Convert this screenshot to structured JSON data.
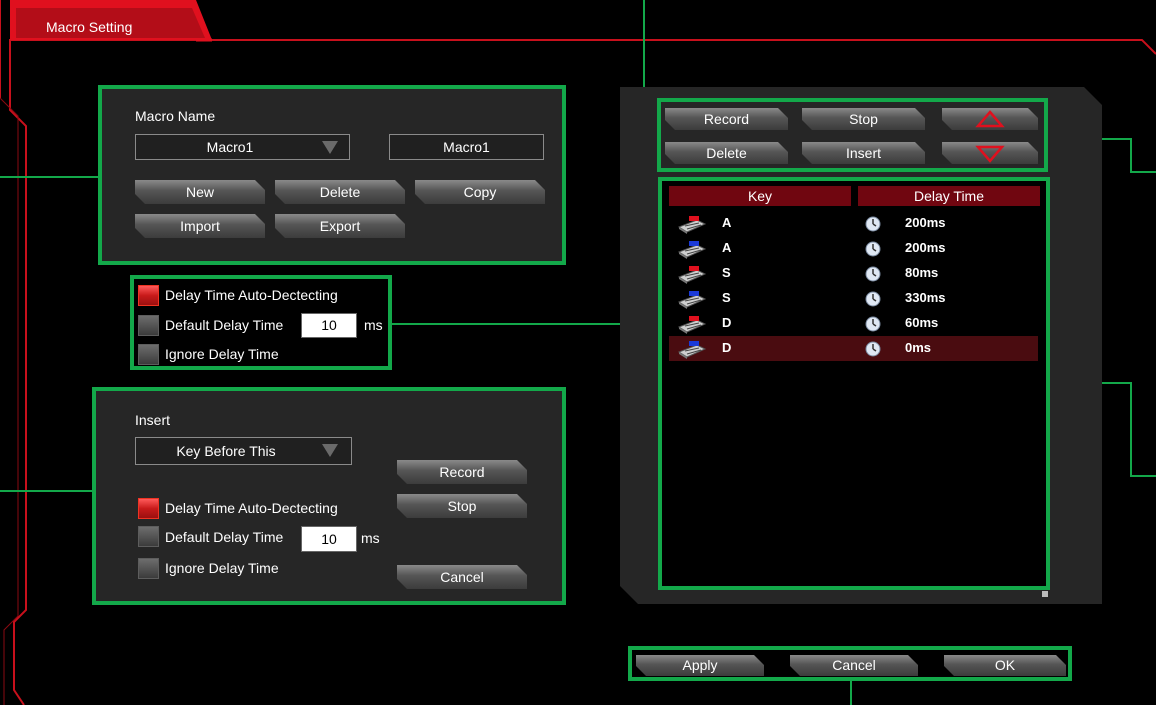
{
  "tab": {
    "title": "Macro Setting"
  },
  "macro": {
    "name_label": "Macro Name",
    "selected": "Macro1",
    "name_value": "Macro1",
    "buttons": {
      "new": "New",
      "delete": "Delete",
      "copy": "Copy",
      "import": "Import",
      "export": "Export"
    }
  },
  "delay_options": {
    "auto": "Delay Time Auto-Dectecting",
    "default": "Default Delay Time",
    "ignore": "Ignore Delay Time",
    "default_value": "10",
    "unit": "ms",
    "auto_checked": true
  },
  "insert": {
    "label": "Insert",
    "selected": "Key Before This",
    "auto": "Delay Time Auto-Dectecting",
    "default": "Default Delay Time",
    "ignore": "Ignore Delay Time",
    "default_value": "10",
    "unit": "ms",
    "record": "Record",
    "stop": "Stop",
    "cancel": "Cancel"
  },
  "toolbar": {
    "record": "Record",
    "stop": "Stop",
    "delete": "Delete",
    "insert": "Insert"
  },
  "table": {
    "headers": {
      "key": "Key",
      "delay": "Delay Time"
    },
    "rows": [
      {
        "key": "A",
        "delay": "200ms",
        "dir": "down"
      },
      {
        "key": "A",
        "delay": "200ms",
        "dir": "up"
      },
      {
        "key": "S",
        "delay": "80ms",
        "dir": "down"
      },
      {
        "key": "S",
        "delay": "330ms",
        "dir": "up"
      },
      {
        "key": "D",
        "delay": "60ms",
        "dir": "down"
      },
      {
        "key": "D",
        "delay": "0ms",
        "dir": "up"
      }
    ],
    "selected_row": 5
  },
  "footer": {
    "apply": "Apply",
    "cancel": "Cancel",
    "ok": "OK"
  },
  "colors": {
    "accent": "#e0101e",
    "highlight": "#13a84a",
    "selected_row": "#4a0c10",
    "header": "#700610"
  }
}
